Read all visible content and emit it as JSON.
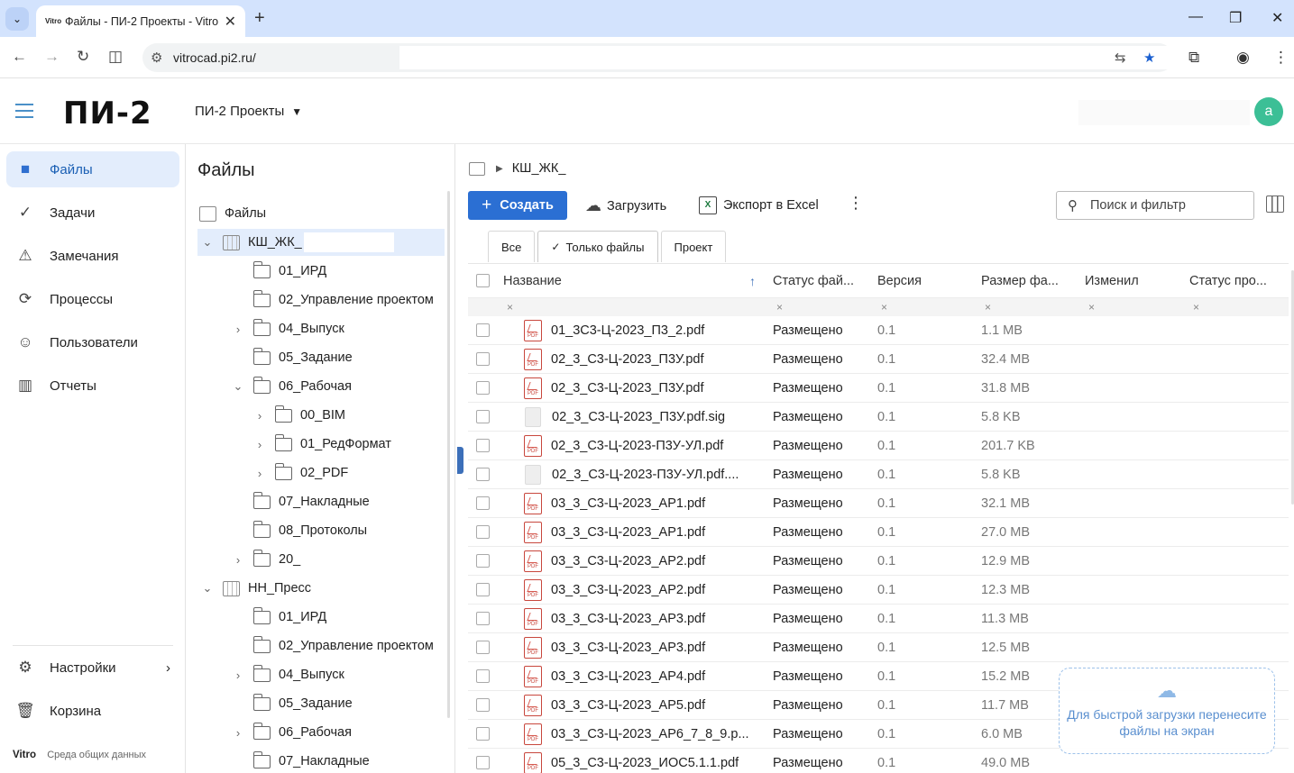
{
  "browser": {
    "tab_favicon": "Vitro",
    "tab_title": "Файлы - ПИ-2 Проекты - Vitro",
    "url": "vitrocad.pi2.ru/"
  },
  "header": {
    "logo": "ПИ-2",
    "project": "ПИ-2 Проекты",
    "avatar_letter": "a"
  },
  "sidebar": {
    "items": [
      {
        "label": "Файлы",
        "icon": "folder-icon",
        "active": true
      },
      {
        "label": "Задачи",
        "icon": "check-circle-icon"
      },
      {
        "label": "Замечания",
        "icon": "warning-icon"
      },
      {
        "label": "Процессы",
        "icon": "process-icon"
      },
      {
        "label": "Пользователи",
        "icon": "users-icon"
      },
      {
        "label": "Отчеты",
        "icon": "report-icon"
      }
    ],
    "settings": "Настройки",
    "trash": "Корзина",
    "footer_brand": "Vitro",
    "footer_text": "Среда общих данных"
  },
  "tree": {
    "title": "Файлы",
    "root": "Файлы",
    "rows": [
      {
        "label": "КШ_ЖК_",
        "level": 0,
        "type": "building",
        "toggle": "expanded",
        "selected": true
      },
      {
        "label": "01_ИРД",
        "level": 1,
        "type": "folder",
        "toggle": ""
      },
      {
        "label": "02_Управление проектом",
        "level": 1,
        "type": "folder",
        "toggle": ""
      },
      {
        "label": "04_Выпуск",
        "level": 1,
        "type": "folder",
        "toggle": "collapsed"
      },
      {
        "label": "05_Задание",
        "level": 1,
        "type": "folder",
        "toggle": ""
      },
      {
        "label": "06_Рабочая",
        "level": 1,
        "type": "folder",
        "toggle": "expanded"
      },
      {
        "label": "00_BIM",
        "level": 2,
        "type": "folder",
        "toggle": "collapsed"
      },
      {
        "label": "01_РедФормат",
        "level": 2,
        "type": "folder",
        "toggle": "collapsed"
      },
      {
        "label": "02_PDF",
        "level": 2,
        "type": "folder",
        "toggle": "collapsed"
      },
      {
        "label": "07_Накладные",
        "level": 1,
        "type": "folder",
        "toggle": ""
      },
      {
        "label": "08_Протоколы",
        "level": 1,
        "type": "folder",
        "toggle": ""
      },
      {
        "label": "20_",
        "level": 1,
        "type": "folder",
        "toggle": "collapsed"
      },
      {
        "label": "НН_Пресс",
        "level": 0,
        "type": "building",
        "toggle": "expanded"
      },
      {
        "label": "01_ИРД",
        "level": 1,
        "type": "folder",
        "toggle": ""
      },
      {
        "label": "02_Управление проектом",
        "level": 1,
        "type": "folder",
        "toggle": ""
      },
      {
        "label": "04_Выпуск",
        "level": 1,
        "type": "folder",
        "toggle": "collapsed"
      },
      {
        "label": "05_Задание",
        "level": 1,
        "type": "folder",
        "toggle": ""
      },
      {
        "label": "06_Рабочая",
        "level": 1,
        "type": "folder",
        "toggle": "collapsed"
      },
      {
        "label": "07_Накладные",
        "level": 1,
        "type": "folder",
        "toggle": ""
      }
    ]
  },
  "main": {
    "breadcrumb": "КШ_ЖК_",
    "create": "Создать",
    "upload": "Загрузить",
    "export": "Экспорт в Excel",
    "excel_badge": "X",
    "search_placeholder": "Поиск и фильтр",
    "tabs": [
      {
        "label": "Все",
        "active": false
      },
      {
        "label": "Только файлы",
        "active": true
      },
      {
        "label": "Проект",
        "active": false
      }
    ],
    "columns": {
      "name": "Название",
      "status": "Статус фай...",
      "version": "Версия",
      "size": "Размер фа...",
      "modified_by": "Изменил",
      "project_status": "Статус про..."
    },
    "filter_clear": "×",
    "rows": [
      {
        "name": "01_3С3-Ц-2023_П3_2.pdf",
        "type": "pdf",
        "status": "Размещено",
        "version": "0.1",
        "size": "1.1 MB"
      },
      {
        "name": "02_3_С3-Ц-2023_П3У.pdf",
        "type": "pdf",
        "status": "Размещено",
        "version": "0.1",
        "size": "32.4 MB"
      },
      {
        "name": "02_3_С3-Ц-2023_П3У.pdf",
        "type": "pdf",
        "status": "Размещено",
        "version": "0.1",
        "size": "31.8 MB"
      },
      {
        "name": "02_3_С3-Ц-2023_П3У.pdf.sig",
        "type": "sig",
        "status": "Размещено",
        "version": "0.1",
        "size": "5.8 KB"
      },
      {
        "name": "02_3_С3-Ц-2023-П3У-УЛ.pdf",
        "type": "pdf",
        "status": "Размещено",
        "version": "0.1",
        "size": "201.7 KB"
      },
      {
        "name": "02_3_С3-Ц-2023-П3У-УЛ.pdf....",
        "type": "sig",
        "status": "Размещено",
        "version": "0.1",
        "size": "5.8 KB"
      },
      {
        "name": "03_3_С3-Ц-2023_АР1.pdf",
        "type": "pdf",
        "status": "Размещено",
        "version": "0.1",
        "size": "32.1 MB"
      },
      {
        "name": "03_3_С3-Ц-2023_АР1.pdf",
        "type": "pdf",
        "status": "Размещено",
        "version": "0.1",
        "size": "27.0 MB"
      },
      {
        "name": "03_3_С3-Ц-2023_АР2.pdf",
        "type": "pdf",
        "status": "Размещено",
        "version": "0.1",
        "size": "12.9 MB"
      },
      {
        "name": "03_3_С3-Ц-2023_АР2.pdf",
        "type": "pdf",
        "status": "Размещено",
        "version": "0.1",
        "size": "12.3 MB"
      },
      {
        "name": "03_3_С3-Ц-2023_АР3.pdf",
        "type": "pdf",
        "status": "Размещено",
        "version": "0.1",
        "size": "11.3 MB"
      },
      {
        "name": "03_3_С3-Ц-2023_АР3.pdf",
        "type": "pdf",
        "status": "Размещено",
        "version": "0.1",
        "size": "12.5 MB"
      },
      {
        "name": "03_3_С3-Ц-2023_АР4.pdf",
        "type": "pdf",
        "status": "Размещено",
        "version": "0.1",
        "size": "15.2 MB"
      },
      {
        "name": "03_3_С3-Ц-2023_АР5.pdf",
        "type": "pdf",
        "status": "Размещено",
        "version": "0.1",
        "size": "11.7 MB"
      },
      {
        "name": "03_3_С3-Ц-2023_АР6_7_8_9.p...",
        "type": "pdf",
        "status": "Размещено",
        "version": "0.1",
        "size": "6.0 MB"
      },
      {
        "name": "05_3_С3-Ц-2023_ИОС5.1.1.pdf",
        "type": "pdf",
        "status": "Размещено",
        "version": "0.1",
        "size": "49.0 MB"
      }
    ],
    "drop_zone": "Для быстрой загрузки перенесите файлы на экран"
  }
}
